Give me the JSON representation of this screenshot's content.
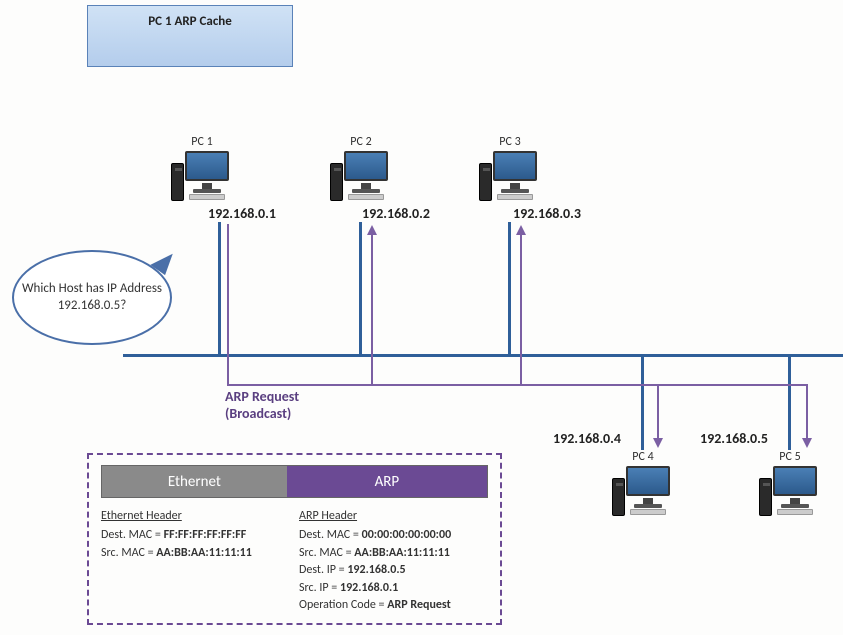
{
  "cache": {
    "title": "PC 1  ARP Cache"
  },
  "speech": {
    "text": "Which Host has IP Address 192.168.0.5?"
  },
  "pcs": {
    "pc1": {
      "label": "PC 1",
      "ip": "192.168.0.1"
    },
    "pc2": {
      "label": "PC 2",
      "ip": "192.168.0.2"
    },
    "pc3": {
      "label": "PC 3",
      "ip": "192.168.0.3"
    },
    "pc4": {
      "label": "PC 4",
      "ip": "192.168.0.4"
    },
    "pc5": {
      "label": "PC 5",
      "ip": "192.168.0.5"
    }
  },
  "request": {
    "line1": "ARP Request",
    "line2": "(Broadcast)"
  },
  "packet": {
    "bar": {
      "eth": "Ethernet",
      "arp": "ARP"
    },
    "eth": {
      "title": "Ethernet Header",
      "dest_label": "Dest. MAC = ",
      "dest_val": "FF:FF:FF:FF:FF:FF",
      "src_label": "Src. MAC = ",
      "src_val": "AA:BB:AA:11:11:11"
    },
    "arp": {
      "title": "ARP Header",
      "dmac_label": "Dest. MAC = ",
      "dmac_val": "00:00:00:00:00:00",
      "smac_label": "Src. MAC = ",
      "smac_val": "AA:BB:AA:11:11:11",
      "dip_label": "Dest. IP = ",
      "dip_val": "192.168.0.5",
      "sip_label": "Src. IP = ",
      "sip_val": "192.168.0.1",
      "op_label": "Operation Code = ",
      "op_val": "ARP Request"
    }
  }
}
